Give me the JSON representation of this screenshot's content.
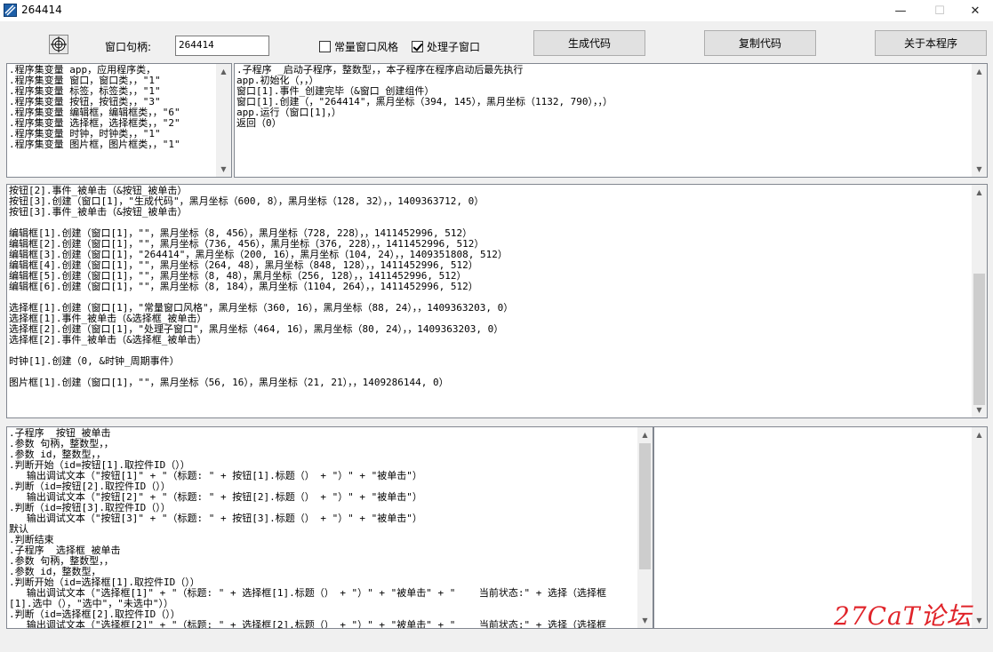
{
  "window": {
    "title": "264414",
    "min_glyph": "—",
    "max_glyph": "☐",
    "close_glyph": "✕"
  },
  "toolbar": {
    "handle_label": "窗口句柄:",
    "handle_value": "264414",
    "checkbox_normal_style": "常量窗口风格",
    "checkbox_process_child": "处理子窗口",
    "btn_generate": "生成代码",
    "btn_copy": "复制代码",
    "btn_about": "关于本程序"
  },
  "panes": {
    "globals": ".程序集变量 app，应用程序类，\n.程序集变量 窗口，窗口类，，\"1\"\n.程序集变量 标签，标签类，，\"1\"\n.程序集变量 按钮，按钮类，，\"3\"\n.程序集变量 编辑框，编辑框类，，\"6\"\n.程序集变量 选择框，选择框类，，\"2\"\n.程序集变量 时钟，时钟类，，\"1\"\n.程序集变量 图片框，图片框类，，\"1\"",
    "startup": ".子程序 _启动子程序，整数型，，本子程序在程序启动后最先执行\napp.初始化（，，）\n窗口[1].事件_创建完毕（&窗口_创建组件）\n窗口[1].创建（，\"264414\"，黑月坐标（394, 145），黑月坐标（1132, 790），，）\napp.运行（窗口[1]，）\n返回（0）",
    "controls": "按钮[2].事件_被单击（&按钮_被单击）\n按钮[3].创建（窗口[1]，\"生成代码\"，黑月坐标（600, 8），黑月坐标（128, 32），，1409363712, 0）\n按钮[3].事件_被单击（&按钮_被单击）\n\n编辑框[1].创建（窗口[1]，\"\"，黑月坐标（8, 456），黑月坐标（728, 228），，1411452996, 512）\n编辑框[2].创建（窗口[1]，\"\"，黑月坐标（736, 456），黑月坐标（376, 228），，1411452996, 512）\n编辑框[3].创建（窗口[1]，\"264414\"，黑月坐标（200, 16），黑月坐标（104, 24），，1409351808, 512）\n编辑框[4].创建（窗口[1]，\"\"，黑月坐标（264, 48），黑月坐标（848, 128），，1411452996, 512）\n编辑框[5].创建（窗口[1]，\"\"，黑月坐标（8, 48），黑月坐标（256, 128），，1411452996, 512）\n编辑框[6].创建（窗口[1]，\"\"，黑月坐标（8, 184），黑月坐标（1104, 264），，1411452996, 512）\n\n选择框[1].创建（窗口[1]，\"常量窗口风格\"，黑月坐标（360, 16），黑月坐标（88, 24），，1409363203, 0）\n选择框[1].事件_被单击（&选择框_被单击）\n选择框[2].创建（窗口[1]，\"处理子窗口\"，黑月坐标（464, 16），黑月坐标（80, 24），，1409363203, 0）\n选择框[2].事件_被单击（&选择框_被单击）\n\n时钟[1].创建（0, &时钟_周期事件）\n\n图片框[1].创建（窗口[1]，\"\"，黑月坐标（56, 16），黑月坐标（21, 21），，1409286144, 0）",
    "events": ".子程序 _按钮_被单击\n.参数 句柄，整数型，，\n.参数 id，整数型，，\n.判断开始（id=按钮[1].取控件ID（））\n   输出调试文本（\"按钮[1]\" + \"（标题: \" + 按钮[1].标题（） + \"）\" + \"被单击\"）\n.判断（id=按钮[2].取控件ID（））\n   输出调试文本（\"按钮[2]\" + \"（标题: \" + 按钮[2].标题（） + \"）\" + \"被单击\"）\n.判断（id=按钮[3].取控件ID（））\n   输出调试文本（\"按钮[3]\" + \"（标题: \" + 按钮[3].标题（） + \"）\" + \"被单击\"）\n默认\n.判断结束\n.子程序 _选择框_被单击\n.参数 句柄，整数型，，\n.参数 id，整数型，\n.判断开始（id=选择框[1].取控件ID（））\n   输出调试文本（\"选择框[1]\" + \"（标题: \" + 选择框[1].标题（） + \"）\" + \"被单击\" + \"    当前状态:\" + 选择（选择框\n[1].选中（），\"选中\"，\"未选中\"））\n.判断（id=选择框[2].取控件ID（））\n   输出调试文本（\"选择框[2]\" + \"（标题: \" + 选择框[2].标题（） + \"）\" + \"被单击\" + \"    当前状态:\" + 选择（选择框",
    "output": ""
  },
  "watermark": "27CaT论坛",
  "colors": {
    "accent_watermark": "#e0242a",
    "window_bg": "#f0f0f0"
  }
}
